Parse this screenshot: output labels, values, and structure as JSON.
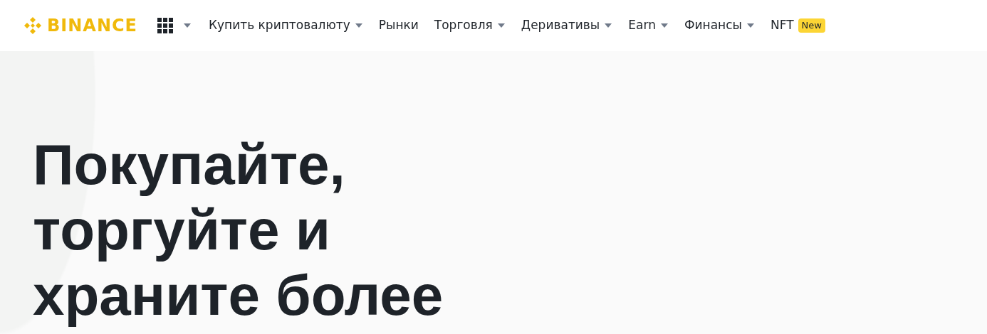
{
  "header": {
    "logo_text": "BINANCE",
    "nav": [
      {
        "label": "Купить криптовалюту",
        "dropdown": true
      },
      {
        "label": "Рынки",
        "dropdown": false
      },
      {
        "label": "Торговля",
        "dropdown": true
      },
      {
        "label": "Деривативы",
        "dropdown": true
      },
      {
        "label": "Earn",
        "dropdown": true
      },
      {
        "label": "Финансы",
        "dropdown": true
      },
      {
        "label": "NFT",
        "dropdown": false,
        "badge": "New"
      }
    ]
  },
  "hero": {
    "headline_lines": [
      "Покупайте,",
      "торгуйте и",
      "храните более"
    ]
  }
}
